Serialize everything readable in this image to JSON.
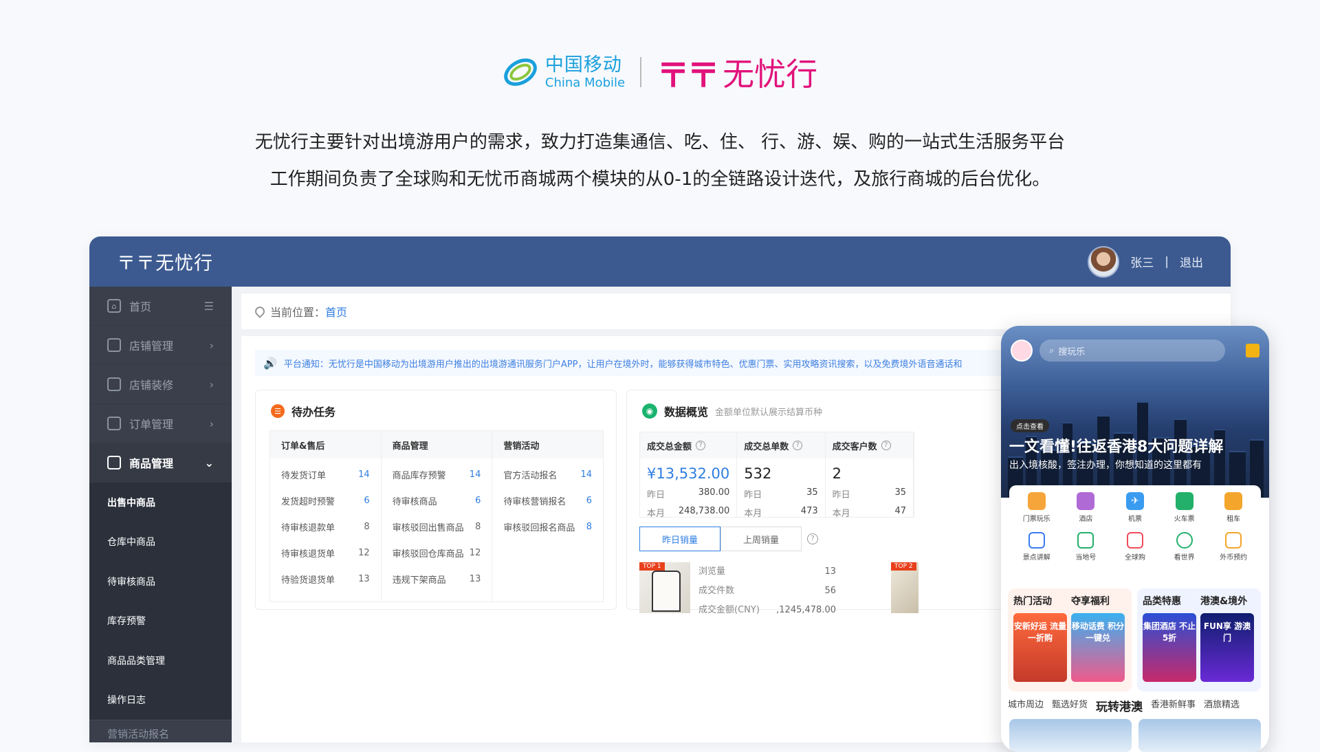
{
  "brand": {
    "china_mobile_cn": "中国移动",
    "china_mobile_en": "China Mobile",
    "wuyouxing": "无忧行",
    "wuyouxing_mark": "〒〒"
  },
  "intro": {
    "line1": "无忧行主要针对出境游用户的需求，致力打造集通信、吃、住、 行、游、娱、购的一站式生活服务平台",
    "line2": "工作期间负责了全球购和无忧币商城两个模块的从0-1的全链路设计迭代，及旅行商城的后台优化。"
  },
  "topbar": {
    "logo": "〒〒无忧行",
    "user": "张三",
    "sep": "|",
    "logout": "退出"
  },
  "sidebar": {
    "items": [
      {
        "label": "首页",
        "icon": "home-icon"
      },
      {
        "label": "店铺管理",
        "icon": "shop-icon"
      },
      {
        "label": "店铺装修",
        "icon": "decor-icon"
      },
      {
        "label": "订单管理",
        "icon": "order-icon"
      },
      {
        "label": "商品管理",
        "icon": "goods-icon"
      }
    ],
    "sub": [
      "出售中商品",
      "仓库中商品",
      "待审核商品",
      "库存预警",
      "商品品类管理",
      "操作日志"
    ],
    "bottom": "营销活动报名"
  },
  "breadcrumb": {
    "prefix": "当前位置：",
    "current": "首页"
  },
  "notice": "平台通知：无忧行是中国移动为出境游用户推出的出境游通讯服务门户APP，让用户在境外时，能够获得城市特色、优惠门票、实用攻略资讯搜索，以及免费境外语音通话和",
  "todo": {
    "title": "待办任务",
    "columns": [
      {
        "head": "订单&售后",
        "rows": [
          {
            "label": "待发货订单",
            "num": "14",
            "blue": true
          },
          {
            "label": "发货超时预警",
            "num": "6",
            "blue": true
          },
          {
            "label": "待审核退款单",
            "num": "8",
            "blue": false
          },
          {
            "label": "待审核退货单",
            "num": "12",
            "blue": false
          },
          {
            "label": "待验货退货单",
            "num": "13",
            "blue": false
          }
        ]
      },
      {
        "head": "商品管理",
        "rows": [
          {
            "label": "商品库存预警",
            "num": "14",
            "blue": true
          },
          {
            "label": "待审核商品",
            "num": "6",
            "blue": true
          },
          {
            "label": "审核驳回出售商品",
            "num": "8",
            "blue": false
          },
          {
            "label": "审核驳回仓库商品",
            "num": "12",
            "blue": false
          },
          {
            "label": "违规下架商品",
            "num": "13",
            "blue": false
          }
        ]
      },
      {
        "head": "营销活动",
        "rows": [
          {
            "label": "官方活动报名",
            "num": "14",
            "blue": true
          },
          {
            "label": "待审核营销报名",
            "num": "6",
            "blue": true
          },
          {
            "label": "审核驳回报名商品",
            "num": "8",
            "blue": true
          }
        ]
      }
    ]
  },
  "overview": {
    "title": "数据概览",
    "note": "金额单位默认展示结算币种",
    "stats": [
      {
        "head": "成交总金额",
        "value": "¥13,532.00",
        "blue": true,
        "y_label": "昨日",
        "y_val": "380.00",
        "m_label": "本月",
        "m_val": "248,738.00"
      },
      {
        "head": "成交总单数",
        "value": "532",
        "blue": false,
        "y_label": "昨日",
        "y_val": "35",
        "m_label": "本月",
        "m_val": "473"
      },
      {
        "head": "成交客户数",
        "value": "2",
        "blue": false,
        "y_label": "昨日",
        "y_val": "35",
        "m_label": "本月",
        "m_val": "47"
      }
    ],
    "seg_on": "昨日销量",
    "seg_off": "上周销量",
    "product": {
      "tag": "TOP 1",
      "views_label": "浏览量",
      "views": "13",
      "count_label": "成交件数",
      "count": "56",
      "amount_label": "成交金额(CNY)",
      "amount": ",1245,478.00"
    },
    "product2_tag": "TOP 2"
  },
  "phone": {
    "search": "搜玩乐",
    "tag": "点击查看",
    "title": "一文看懂!往返香港8大问题详解",
    "subtitle": "出入境核酸，签注办理，你想知道的这里都有",
    "icons": [
      {
        "label": "门票玩乐",
        "icon": "ticket-icon",
        "color": "#f6a53a"
      },
      {
        "label": "酒店",
        "icon": "hotel-icon",
        "color": "#b06ad6"
      },
      {
        "label": "机票",
        "icon": "plane-icon",
        "color": "#3a9cf0"
      },
      {
        "label": "火车票",
        "icon": "train-icon",
        "color": "#23b06a"
      },
      {
        "label": "租车",
        "icon": "car-icon",
        "color": "#f3a52c"
      },
      {
        "label": "景点讲解",
        "icon": "headphone-icon",
        "color": "#3a7bf0"
      },
      {
        "label": "当地号",
        "icon": "sim-icon",
        "color": "#23b06a"
      },
      {
        "label": "全球购",
        "icon": "bag-icon",
        "color": "#f04b5b"
      },
      {
        "label": "看世界",
        "icon": "eye-icon",
        "color": "#23b06a"
      },
      {
        "label": "外币预约",
        "icon": "money-icon",
        "color": "#f3a52c"
      }
    ],
    "promo_left": {
      "t1": "热门活动",
      "t2": "夺享福利",
      "img1": "安新好运 流量一折购",
      "img2": "移动话费 积分一键兑"
    },
    "promo_right": {
      "t1": "品类特惠",
      "t2": "港澳&境外",
      "img1": "集团酒店 不止5折",
      "img2": "FUN享 游澳门"
    },
    "tabs": [
      "城市周边",
      "甄选好货",
      "玩转港澳",
      "香港新鲜事",
      "酒旅精选"
    ]
  },
  "colors": {
    "topbar": "#3c5a90",
    "sidebar": "#3a3f4b",
    "accent": "#2f7de1",
    "brand_pink": "#e2127b",
    "cm_blue": "#1aa0dc"
  }
}
